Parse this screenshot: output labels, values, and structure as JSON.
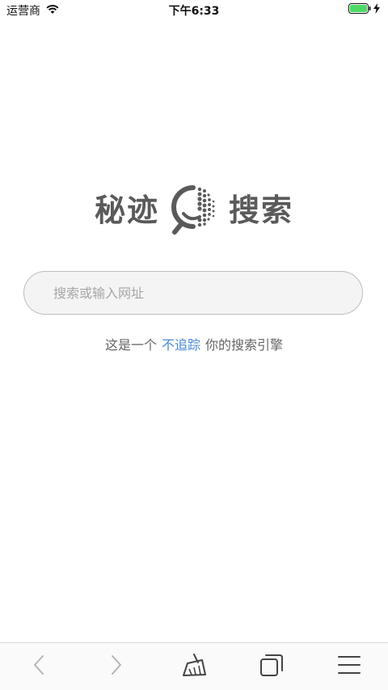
{
  "status_bar": {
    "carrier": "运营商",
    "time": "下午6:33",
    "wifi_icon": "wifi-icon",
    "battery_icon": "battery-icon",
    "battery_color": "#4cd964"
  },
  "logo": {
    "left_text": "秘迹",
    "right_text": "搜索",
    "icon": "magnifier-logo-icon",
    "color": "#5a5a5a"
  },
  "search": {
    "placeholder": "搜索或输入网址",
    "value": ""
  },
  "tagline": {
    "prefix": "这是一个",
    "link": "不追踪",
    "suffix": "你的搜索引擎",
    "link_color": "#4a8ad6"
  },
  "toolbar": {
    "back_icon": "chevron-left-icon",
    "forward_icon": "chevron-right-icon",
    "clear_icon": "broom-icon",
    "tabs_icon": "tabs-icon",
    "menu_icon": "menu-icon"
  }
}
